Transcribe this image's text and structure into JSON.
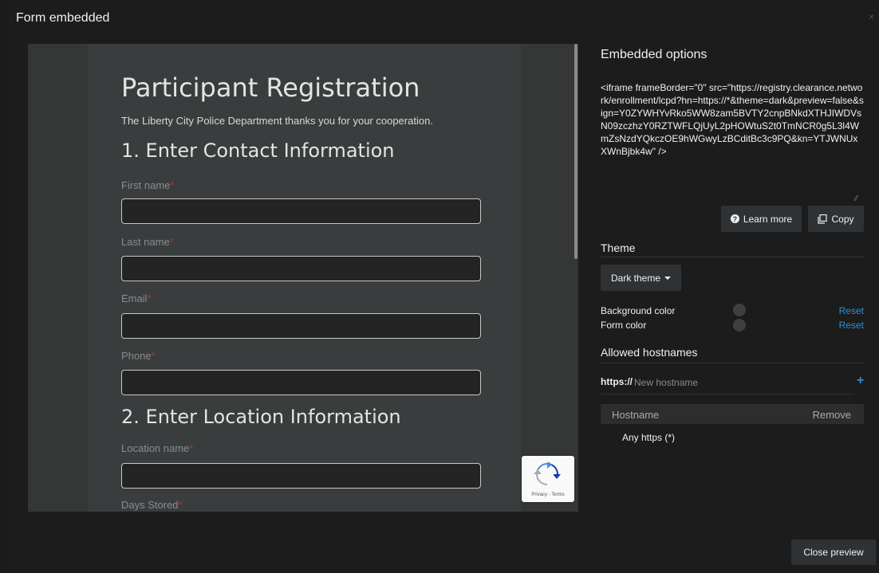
{
  "window": {
    "title": "Form embedded",
    "close_glyph": "×"
  },
  "preview": {
    "form_title": "Participant Registration",
    "form_subtitle": "The Liberty City Police Department thanks you for your cooperation.",
    "section1": "1. Enter Contact Information",
    "section2": "2. Enter Location Information",
    "fields": [
      {
        "label": "First name",
        "required": "*"
      },
      {
        "label": "Last name",
        "required": "*"
      },
      {
        "label": "Email",
        "required": "*"
      },
      {
        "label": "Phone",
        "required": "*"
      },
      {
        "label": "Location name",
        "required": "*"
      },
      {
        "label": "Days Stored",
        "required": "*"
      }
    ],
    "recaptcha_text": "Privacy - Terms"
  },
  "options": {
    "title": "Embedded options",
    "embed_code": "<iframe frameBorder=\"0\" src=\"https://registry.clearance.network/enrollment/lcpd?hn=https://*&theme=dark&preview=false&sign=Y0ZYWHYvRko5WW8zam5BVTY2cnpBNkdXTHJIWDVsN09zczhzY0RZTWFLQjUyL2pHOWtuS2t0TmNCR0g5L3l4WmZsNzdYQkczOE9hWGwyLzBCditBc3c9PQ&kn=YTJWNUxXWnBjbk4w\" />",
    "learn_more": "Learn more",
    "copy": "Copy",
    "theme_heading": "Theme",
    "theme_value": "Dark theme",
    "background_color_label": "Background color",
    "form_color_label": "Form color",
    "reset": "Reset",
    "hostnames_heading": "Allowed hostnames",
    "host_prefix": "https://",
    "host_placeholder": "New hostname",
    "table": {
      "col_hostname": "Hostname",
      "col_remove": "Remove",
      "rows": [
        {
          "hostname": "Any https (*)"
        }
      ]
    }
  },
  "footer": {
    "close_preview": "Close preview"
  },
  "colors": {
    "accent": "#2e8fd6",
    "required": "#b03636",
    "background": "#1c1c1c"
  }
}
